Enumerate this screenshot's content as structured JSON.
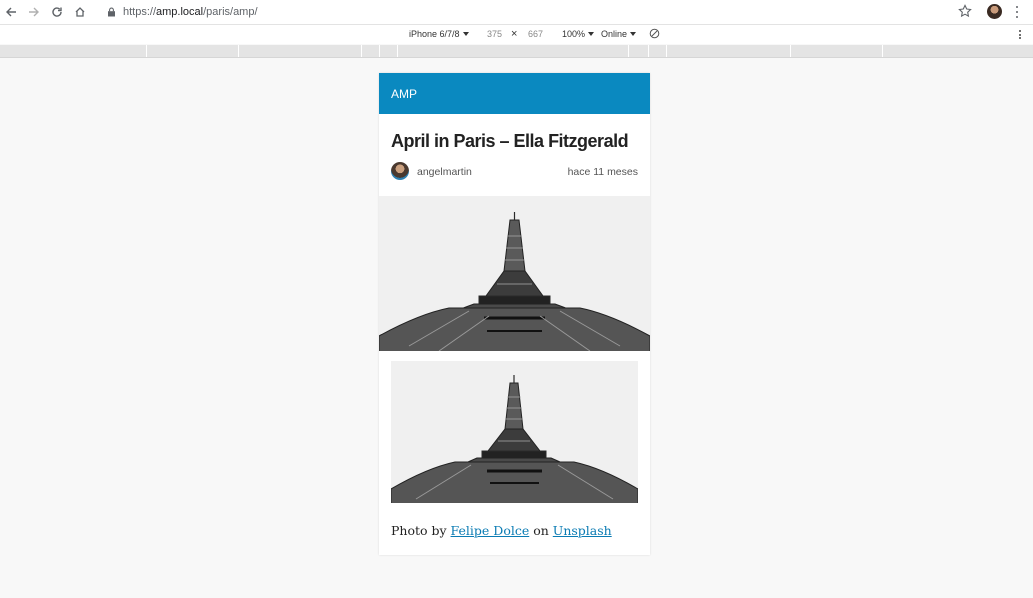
{
  "browser": {
    "url_scheme": "https://",
    "url_host": "amp.local",
    "url_path": "/paris/amp/",
    "icons": [
      "back-icon",
      "forward-icon",
      "reload-icon",
      "home-icon",
      "lock-icon",
      "star-icon",
      "profile-avatar",
      "menu-icon"
    ]
  },
  "device_toolbar": {
    "device": "iPhone 6/7/8",
    "width": "375",
    "times": "×",
    "height": "667",
    "zoom": "100%",
    "network": "Online"
  },
  "page": {
    "header_label": "AMP",
    "header_color": "#0a89c0",
    "title": "April in Paris – Ella Fitzgerald",
    "author": "angelmartin",
    "time_ago": "hace 11 meses",
    "caption_prefix": "Photo by ",
    "caption_author": "Felipe Dolce",
    "caption_mid": " on ",
    "caption_site": "Unsplash",
    "link_color": "#0a7bb3"
  }
}
